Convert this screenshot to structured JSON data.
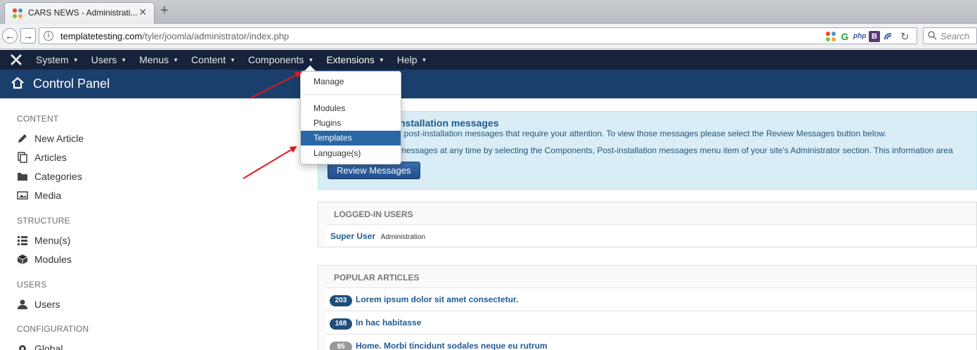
{
  "browser": {
    "tab_title": "CARS NEWS - Administrati...",
    "tab_close": "✕",
    "new_tab": "+",
    "back": "←",
    "forward": "→",
    "info": "i",
    "url_domain": "templatetesting.com",
    "url_path": "/tyler/joomla/administrator/index.php",
    "reload": "↻",
    "search_placeholder": "Search",
    "ext_icons": [
      "joomla-icon",
      "g-icon",
      "php-icon",
      "b-icon",
      "wave-icon"
    ]
  },
  "nav": {
    "items": [
      {
        "label": "System"
      },
      {
        "label": "Users"
      },
      {
        "label": "Menus"
      },
      {
        "label": "Content"
      },
      {
        "label": "Components"
      },
      {
        "label": "Extensions"
      },
      {
        "label": "Help"
      }
    ]
  },
  "header": {
    "title": "Control Panel"
  },
  "sidebar": {
    "content_heading": "CONTENT",
    "new_article": "New Article",
    "articles": "Articles",
    "categories": "Categories",
    "media": "Media",
    "structure_heading": "STRUCTURE",
    "menus": "Menu(s)",
    "modules": "Modules",
    "users_heading": "USERS",
    "users": "Users",
    "configuration_heading": "CONFIGURATION",
    "global": "Global"
  },
  "message": {
    "title": "nstallation messages",
    "line1": "t post-installation messages that require your attention. To view those messages please select the Review Messages button below.",
    "line2": "messages at any time by selecting the Components, Post-installation messages menu item of your site's Administrator section. This information area",
    "button": "Review Messages"
  },
  "logged_in": {
    "title": "LOGGED-IN USERS",
    "user": "Super User",
    "meta": "Administration"
  },
  "popular": {
    "title": "POPULAR ARTICLES",
    "rows": [
      {
        "count": "203",
        "title": "Lorem ipsum dolor sit amet consectetur."
      },
      {
        "count": "168",
        "title": "In hac habitasse"
      },
      {
        "count": "95",
        "title": "Home. Morbi tincidunt sodales neque eu rutrum"
      }
    ]
  },
  "dropdown": {
    "manage": "Manage",
    "modules": "Modules",
    "plugins": "Plugins",
    "templates": "Templates",
    "languages": "Language(s)",
    "highlighted": "Templates"
  },
  "colors": {
    "annotation_arrow": "#e0191e",
    "nav_bg": "#17233a",
    "header_bg": "#1b3f6d",
    "highlight": "#2a67a5"
  }
}
